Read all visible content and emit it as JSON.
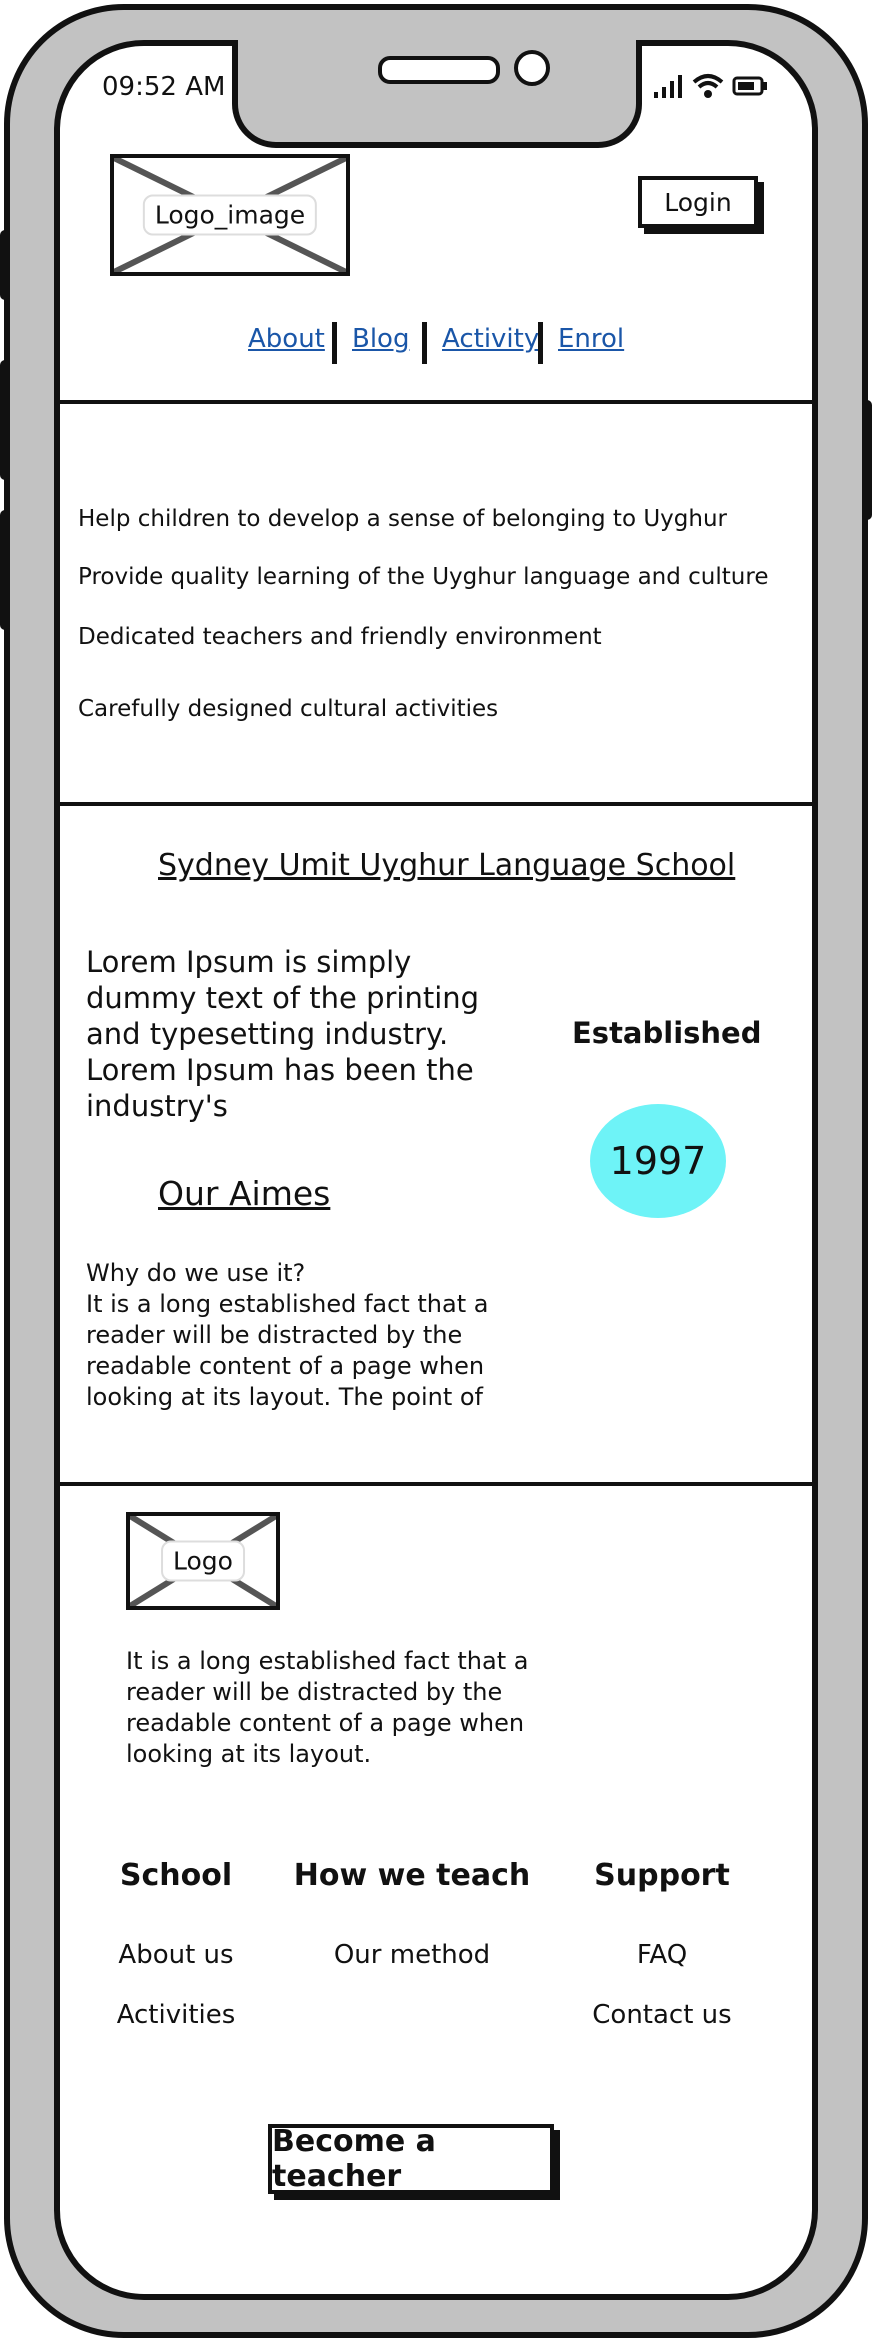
{
  "status_bar": {
    "time": "09:52 AM"
  },
  "header": {
    "logo_label": "Logo_image",
    "login_label": "Login",
    "nav": [
      "About",
      "Blog",
      "Activity",
      "Enrol"
    ]
  },
  "features": [
    "Help children to develop a sense of belonging to Uyghur",
    "Provide quality learning of the Uyghur language and culture",
    "Dedicated teachers and friendly environment",
    "Carefully designed cultural activities"
  ],
  "about": {
    "title": "Sydney Umit Uyghur Language School",
    "intro": "Lorem Ipsum is simply dummy text of the printing and typesetting industry. Lorem Ipsum has been the industry's",
    "established_label": "Established",
    "established_year": "1997",
    "aims_title": "Our Aimes",
    "aims_text_1": "Why do we use it?",
    "aims_text_2": "It is a long established fact that a reader will be distracted by the readable content of a page when looking at its layout. The point of"
  },
  "footer": {
    "logo_label": "Logo",
    "description": "It is a long established fact that a reader will be distracted by the readable content of a page when looking at its layout.",
    "columns": [
      {
        "heading": "School",
        "items": [
          "About us",
          "Activities"
        ]
      },
      {
        "heading": "How we teach",
        "items": [
          "Our method"
        ]
      },
      {
        "heading": "Support",
        "items": [
          "FAQ",
          "Contact us"
        ]
      }
    ],
    "cta_label": "Become a teacher"
  },
  "colors": {
    "accent_circle": "#6ef3f7",
    "link": "#1a56a8",
    "frame": "#c2c2c2"
  }
}
